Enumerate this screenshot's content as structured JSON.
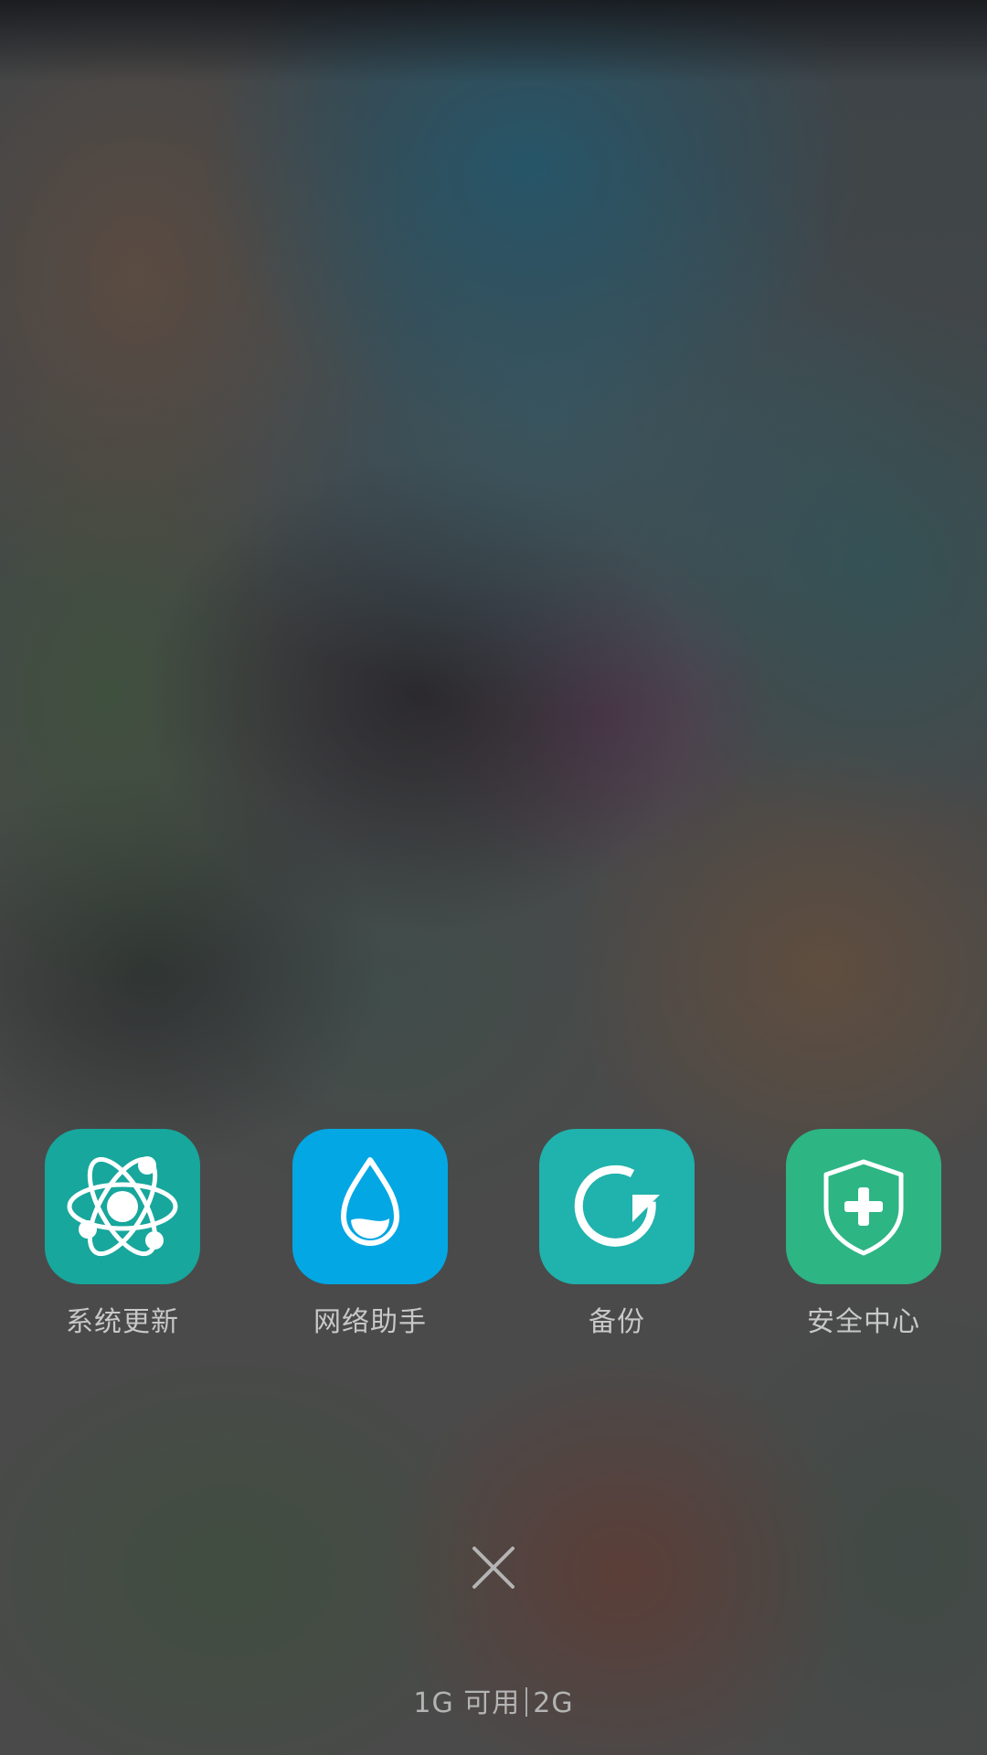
{
  "quick_apps": [
    {
      "label": "系统更新",
      "icon": "atom-icon",
      "color": "#17a79c"
    },
    {
      "label": "网络助手",
      "icon": "water-drop-icon",
      "color": "#03a7e4"
    },
    {
      "label": "备份",
      "icon": "refresh-arrow-icon",
      "color": "#20b2ac"
    },
    {
      "label": "安全中心",
      "icon": "shield-plus-icon",
      "color": "#2db584"
    }
  ],
  "close_button": {
    "icon": "close-icon",
    "color": "#b4b4b4"
  },
  "memory": {
    "available": "1G 可用",
    "total": "2G"
  }
}
